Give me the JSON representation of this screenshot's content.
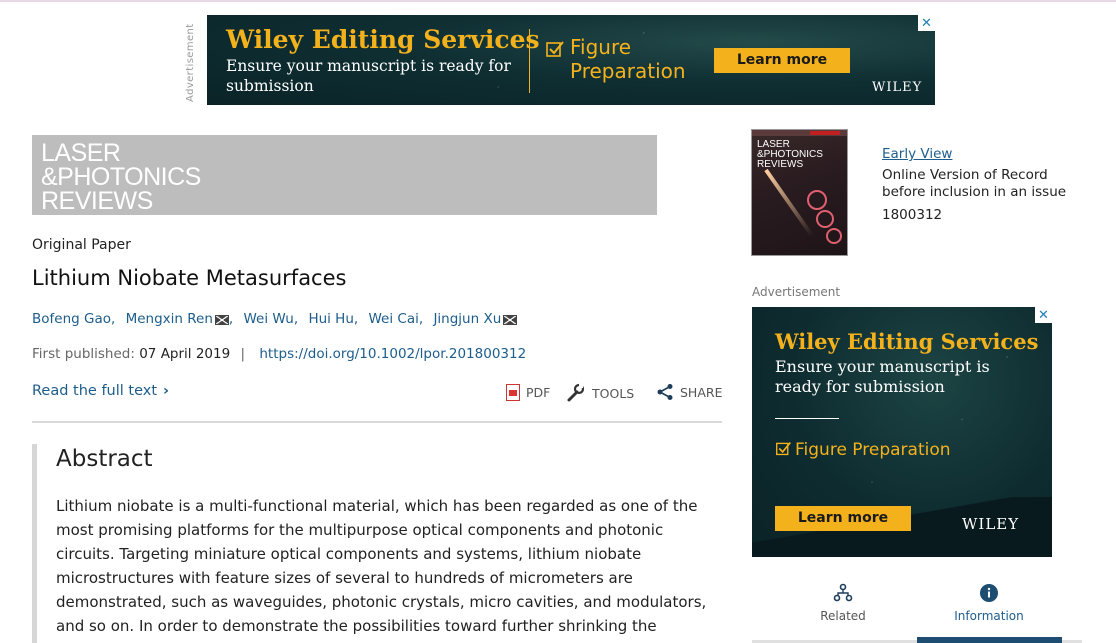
{
  "top_ad": {
    "side_label": "Advertisement",
    "headline": "Wiley Editing Services",
    "subline": "Ensure your manuscript is ready for submission",
    "feature_line1": "Figure",
    "feature_line2": "Preparation",
    "cta": "Learn more",
    "brand": "WILEY",
    "close": "✕"
  },
  "journal": {
    "logo_line1": "LASER",
    "logo_line2": "&PHOTONICS",
    "logo_line3": "REVIEWS"
  },
  "article": {
    "type": "Original Paper",
    "title": "Lithium Niobate Metasurfaces",
    "authors": [
      {
        "name": "Bofeng Gao",
        "email": false
      },
      {
        "name": "Mengxin Ren",
        "email": true
      },
      {
        "name": "Wei Wu",
        "email": false
      },
      {
        "name": "Hui Hu",
        "email": false
      },
      {
        "name": "Wei Cai",
        "email": false
      },
      {
        "name": "Jingjun Xu",
        "email": true
      }
    ],
    "first_published_label": "First published:",
    "first_published_date": "07 April 2019",
    "separator": "|",
    "doi": "https://doi.org/10.1002/lpor.201800312",
    "read_full_text": "Read the full text",
    "read_chevron": "›"
  },
  "toolbar": {
    "pdf_label": "PDF",
    "tools_label": "TOOLS",
    "share_label": "SHARE"
  },
  "abstract": {
    "heading": "Abstract",
    "text": "Lithium niobate is a multi-functional material, which has been regarded as one of the most promising platforms for the multipurpose optical components and photonic circuits. Targeting miniature optical components and systems, lithium niobate microstructures with feature sizes of several to hundreds of micrometers are demonstrated, such as waveguides, photonic crystals, micro cavities, and modulators, and so on. In order to demonstrate the possibilities toward further shrinking the"
  },
  "issue_info": {
    "cover_title": "LASER &PHOTONICS REVIEWS",
    "early_view": "Early View",
    "online_version": "Online Version of Record before inclusion in an issue",
    "article_number": "1800312"
  },
  "side_ad": {
    "label": "Advertisement",
    "headline": "Wiley Editing Services",
    "subline": "Ensure your manuscript is ready for submission",
    "feature": "Figure Preparation",
    "cta": "Learn more",
    "brand": "WILEY",
    "close": "✕"
  },
  "tabs": [
    {
      "label": "Related",
      "icon": "related-icon",
      "active": false
    },
    {
      "label": "Information",
      "icon": "info-icon",
      "active": true
    }
  ],
  "colors": {
    "link": "#1d5d8c",
    "ad_accent": "#f3b21c",
    "ad_bg": "#0e2c30",
    "banner_grey": "#bdbdbd"
  }
}
